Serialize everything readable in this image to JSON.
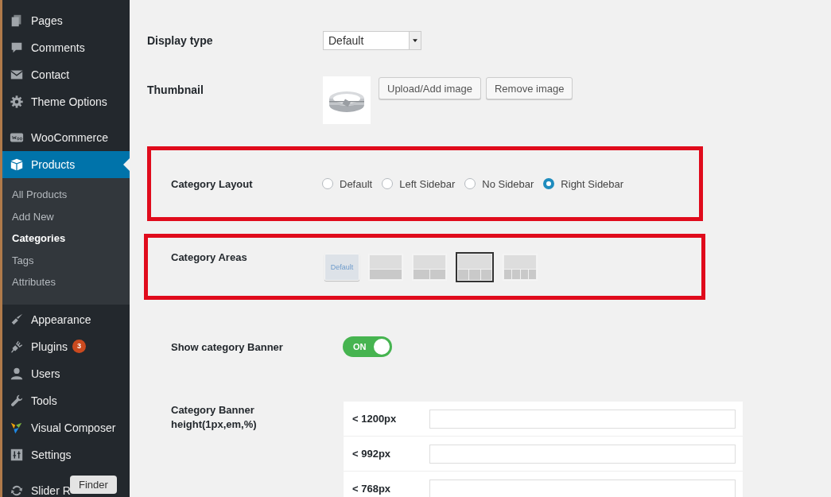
{
  "sidebar": {
    "items": [
      {
        "label": "Pages",
        "selected": false
      },
      {
        "label": "Comments",
        "selected": false
      },
      {
        "label": "Contact",
        "selected": false
      },
      {
        "label": "Theme Options",
        "selected": false
      },
      {
        "label": "WooCommerce",
        "selected": false
      },
      {
        "label": "Products",
        "selected": true,
        "children": [
          {
            "label": "All Products",
            "selected": false
          },
          {
            "label": "Add New",
            "selected": false
          },
          {
            "label": "Categories",
            "selected": true
          },
          {
            "label": "Tags",
            "selected": false
          },
          {
            "label": "Attributes",
            "selected": false
          }
        ]
      },
      {
        "label": "Appearance",
        "selected": false
      },
      {
        "label": "Plugins",
        "selected": false,
        "badge": "3"
      },
      {
        "label": "Users",
        "selected": false
      },
      {
        "label": "Tools",
        "selected": false
      },
      {
        "label": "Visual Composer",
        "selected": false
      },
      {
        "label": "Settings",
        "selected": false
      },
      {
        "label": "Slider R",
        "selected": false
      }
    ]
  },
  "finder_tooltip": "Finder",
  "display_type": {
    "label": "Display type",
    "value": "Default"
  },
  "thumbnail": {
    "label": "Thumbnail",
    "buttons": [
      "Upload/Add image",
      "Remove image"
    ]
  },
  "category_layout": {
    "label": "Category Layout",
    "options": [
      {
        "label": "Default",
        "selected": false
      },
      {
        "label": "Left Sidebar",
        "selected": false
      },
      {
        "label": "No Sidebar",
        "selected": false
      },
      {
        "label": "Right Sidebar",
        "selected": true
      }
    ]
  },
  "category_areas": {
    "label": "Category Areas",
    "options": [
      {
        "kind": "default",
        "label": "Default",
        "selected": false
      },
      {
        "kind": "one",
        "selected": false
      },
      {
        "kind": "two",
        "selected": false
      },
      {
        "kind": "three",
        "selected": true
      },
      {
        "kind": "four",
        "selected": false
      }
    ]
  },
  "show_banner": {
    "label": "Show category Banner",
    "on": true,
    "text": "ON"
  },
  "banner_height": {
    "label": "Category Banner height(1px,em,%)",
    "rows": [
      {
        "label": "< 1200px"
      },
      {
        "label": "< 992px"
      },
      {
        "label": "< 768px"
      }
    ]
  }
}
